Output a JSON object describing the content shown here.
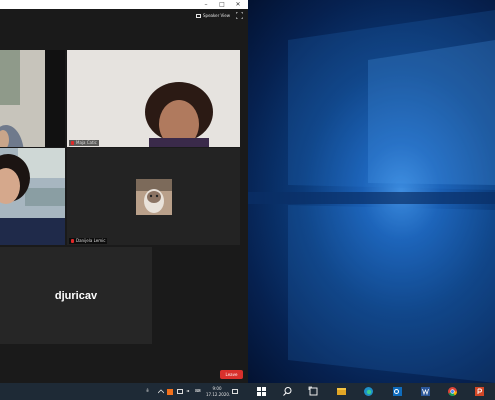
{
  "meeting": {
    "speaker_view_label": "Speaker View",
    "leave_label": "Leave",
    "participants": [
      {
        "name": "Maja Catic"
      },
      {
        "name": "Danijela Lemic"
      }
    ],
    "no_video_username": "djuricav"
  },
  "taskbar": {
    "time": "9:00",
    "date": "17.12.2020."
  },
  "colors": {
    "leave": "#d9302c",
    "muted_mic": "#e02828",
    "desktop_blue": "#1a5fb4"
  }
}
